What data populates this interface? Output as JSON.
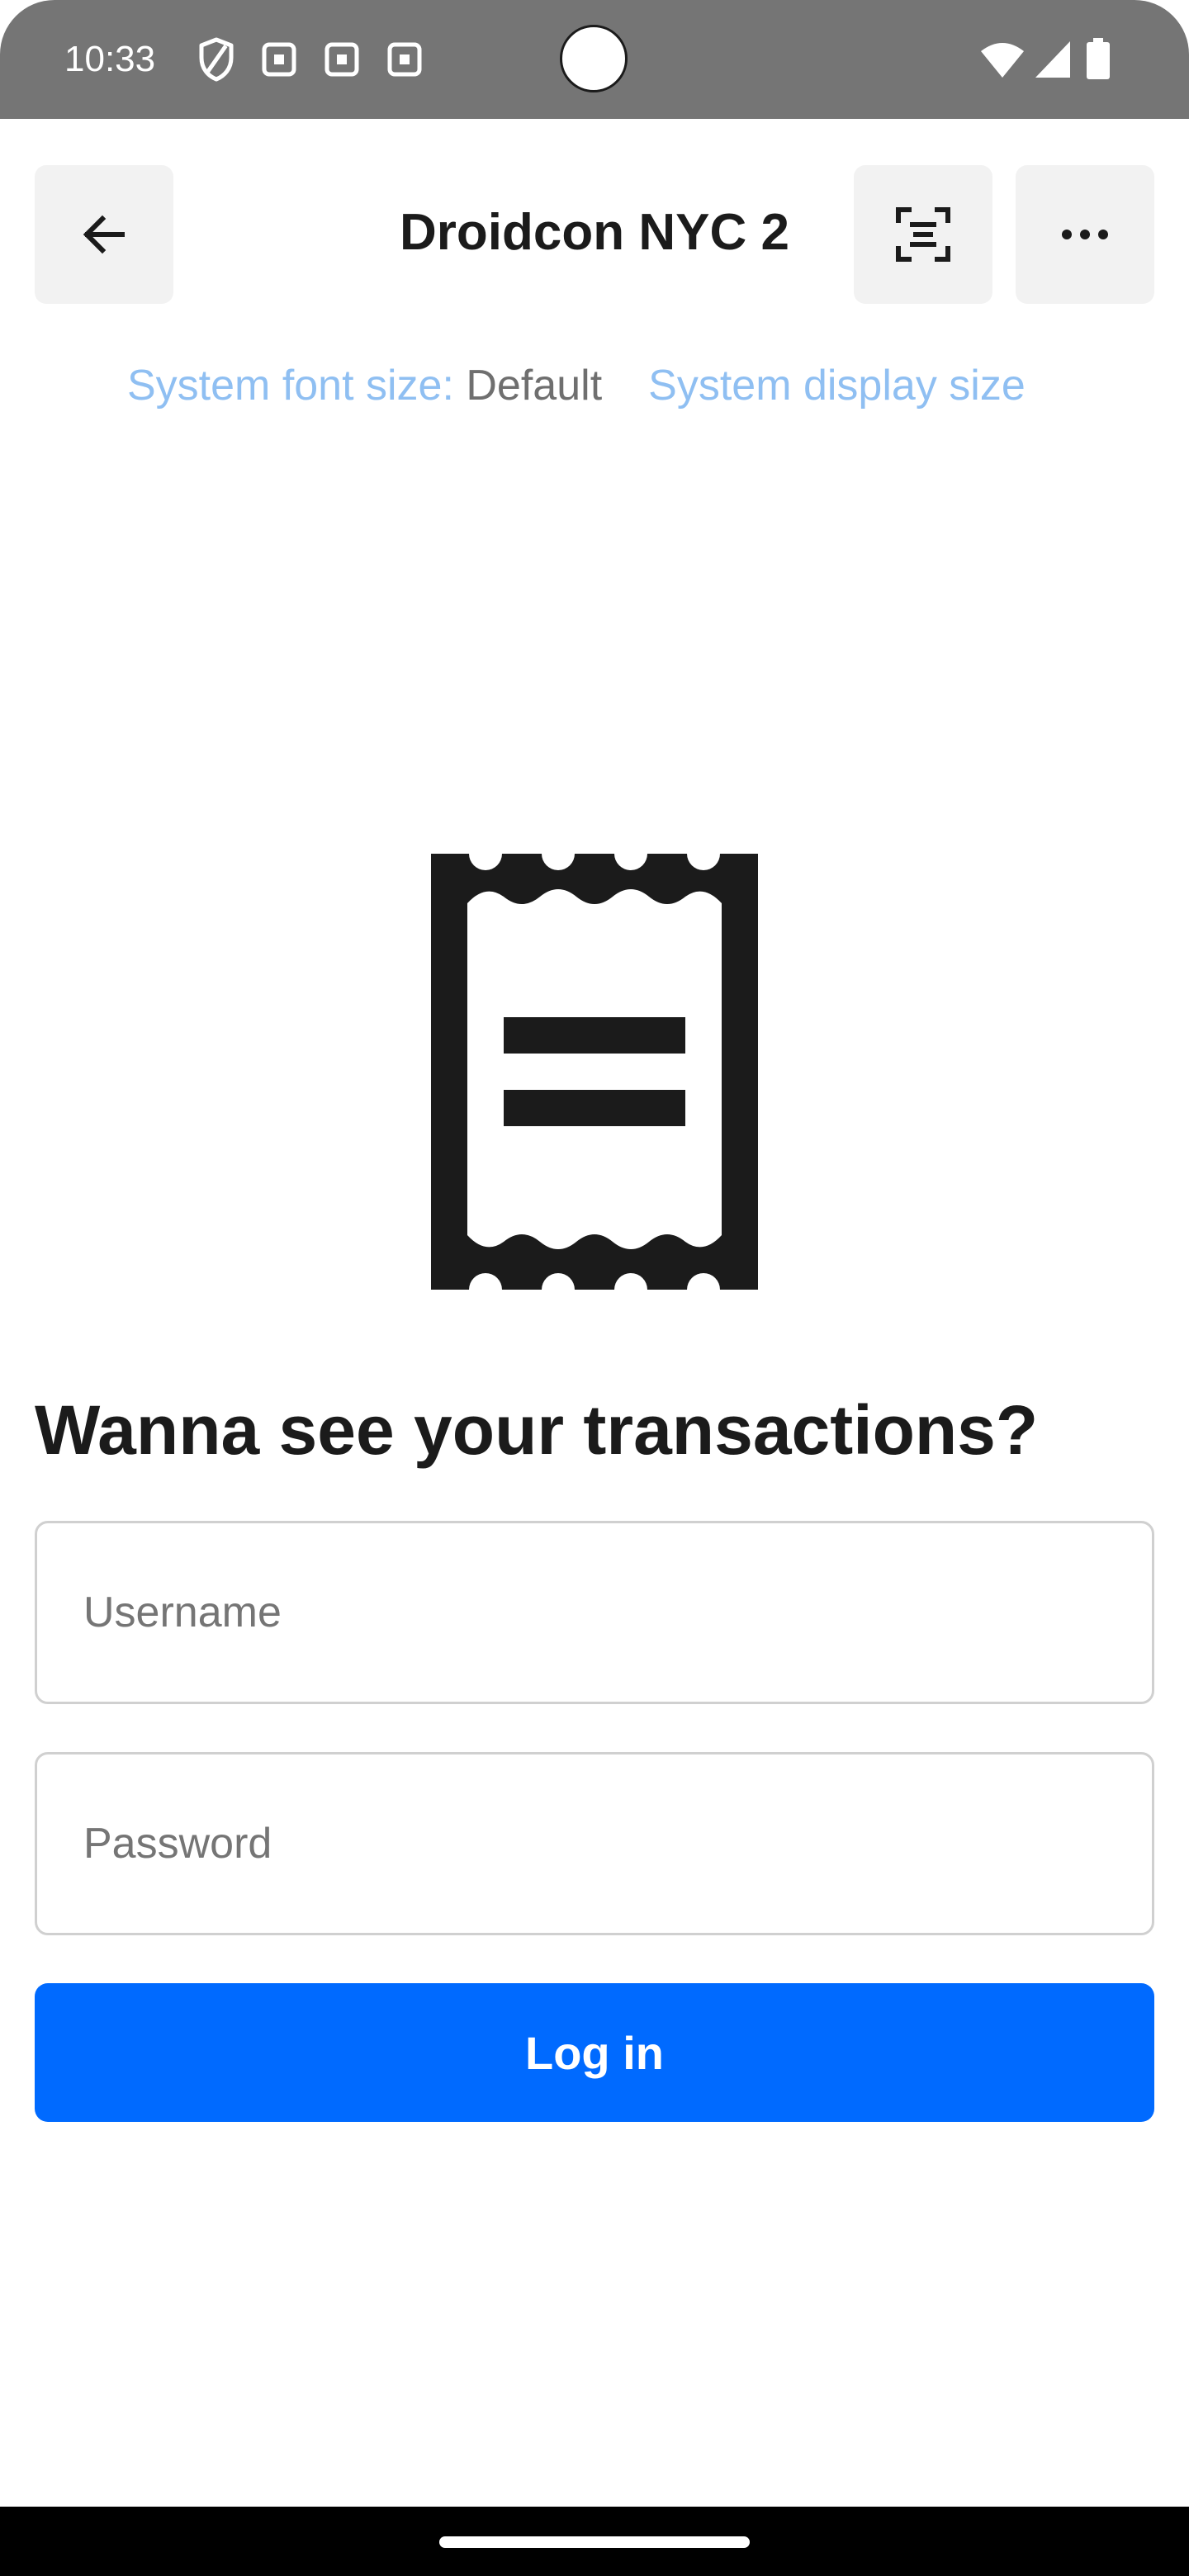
{
  "status_bar": {
    "time": "10:33",
    "icons_left": [
      "shield-icon",
      "notification-square-icon",
      "notification-square-icon",
      "notification-square-icon"
    ],
    "icons_right": [
      "wifi-icon",
      "cellular-signal-icon",
      "battery-icon"
    ]
  },
  "toolbar": {
    "title": "Droidcon NYC 2",
    "back_icon": "arrow-back-icon",
    "scan_icon": "document-scan-icon",
    "more_icon": "more-horizontal-icon"
  },
  "config": {
    "font_size_label": "System font size: ",
    "font_size_value": "Default",
    "display_size_label": "System display size"
  },
  "main": {
    "illustration_icon": "receipt-icon",
    "heading": "Wanna see your transactions?",
    "username_placeholder": "Username",
    "password_placeholder": "Password",
    "login_label": "Log in"
  },
  "colors": {
    "accent": "#006aff",
    "status_bar": "#757575",
    "config_label": "#8fbff2",
    "text_primary": "#1b1b1b"
  }
}
